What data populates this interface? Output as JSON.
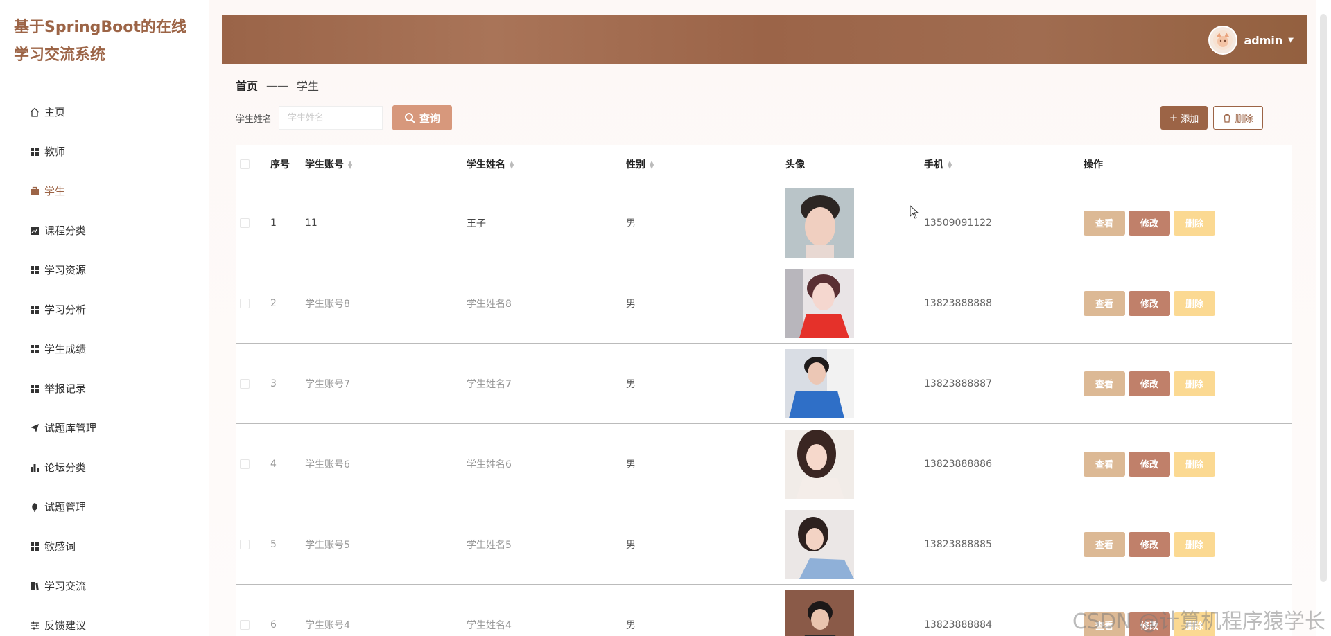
{
  "app": {
    "title": "基于SpringBoot的在线学习交流系统"
  },
  "sidebar": {
    "items": [
      {
        "label": "主页",
        "icon": "home-icon"
      },
      {
        "label": "教师",
        "icon": "grid-icon"
      },
      {
        "label": "学生",
        "icon": "briefcase-icon",
        "active": true
      },
      {
        "label": "课程分类",
        "icon": "chart-icon"
      },
      {
        "label": "学习资源",
        "icon": "grid-icon"
      },
      {
        "label": "学习分析",
        "icon": "grid-icon"
      },
      {
        "label": "学生成绩",
        "icon": "grid-icon"
      },
      {
        "label": "举报记录",
        "icon": "grid-icon"
      },
      {
        "label": "试题库管理",
        "icon": "send-icon"
      },
      {
        "label": "论坛分类",
        "icon": "bar-chart-icon"
      },
      {
        "label": "试题管理",
        "icon": "leaf-icon"
      },
      {
        "label": "敏感词",
        "icon": "grid-icon"
      },
      {
        "label": "学习交流",
        "icon": "book-icon"
      },
      {
        "label": "反馈建议",
        "icon": "sliders-icon"
      }
    ]
  },
  "header": {
    "username": "admin"
  },
  "breadcrumb": {
    "home": "首页",
    "separator": "——",
    "current": "学生"
  },
  "search": {
    "label": "学生姓名",
    "placeholder": "学生姓名",
    "value": "",
    "button": "查询"
  },
  "actions": {
    "add": "添加",
    "delete": "删除"
  },
  "table": {
    "columns": [
      "序号",
      "学生账号",
      "学生姓名",
      "性别",
      "头像",
      "手机",
      "操作"
    ],
    "rows": [
      {
        "index": "1",
        "account": "11",
        "name": "王子",
        "gender": "男",
        "phone": "13509091122"
      },
      {
        "index": "2",
        "account": "学生账号8",
        "name": "学生姓名8",
        "gender": "男",
        "phone": "13823888888"
      },
      {
        "index": "3",
        "account": "学生账号7",
        "name": "学生姓名7",
        "gender": "男",
        "phone": "13823888887"
      },
      {
        "index": "4",
        "account": "学生账号6",
        "name": "学生姓名6",
        "gender": "男",
        "phone": "13823888886"
      },
      {
        "index": "5",
        "account": "学生账号5",
        "name": "学生姓名5",
        "gender": "男",
        "phone": "13823888885"
      },
      {
        "index": "6",
        "account": "学生账号4",
        "name": "学生姓名4",
        "gender": "男",
        "phone": "13823888884"
      }
    ],
    "row_actions": {
      "view": "查看",
      "edit": "修改",
      "delete": "删除"
    }
  },
  "watermark": "CSDN @计算机程序猿学长",
  "colors": {
    "accent": "#9c6446",
    "view": "#dcb995",
    "edit": "#c0806a",
    "delete": "#fbd992",
    "search": "#d7987c"
  }
}
